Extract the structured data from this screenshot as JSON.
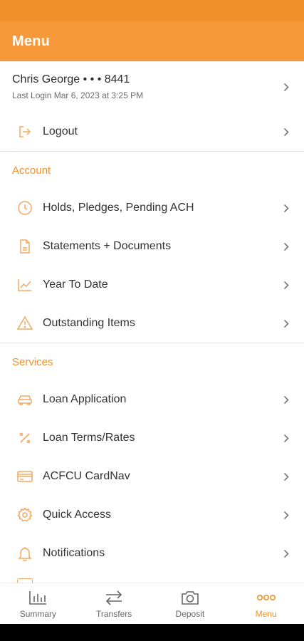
{
  "header": {
    "title": "Menu"
  },
  "user": {
    "name": "Chris George • • • 8441",
    "last_login": "Last Login Mar 6, 2023 at 3:25 PM"
  },
  "logout": {
    "label": "Logout",
    "icon": "logout-icon"
  },
  "account": {
    "title": "Account",
    "items": [
      {
        "label": "Holds, Pledges, Pending ACH",
        "icon": "clock-icon"
      },
      {
        "label": "Statements + Documents",
        "icon": "document-icon"
      },
      {
        "label": "Year To Date",
        "icon": "line-chart-icon"
      },
      {
        "label": "Outstanding Items",
        "icon": "warning-icon"
      }
    ]
  },
  "services": {
    "title": "Services",
    "items": [
      {
        "label": "Loan Application",
        "icon": "car-icon"
      },
      {
        "label": "Loan Terms/Rates",
        "icon": "percent-icon"
      },
      {
        "label": "ACFCU CardNav",
        "icon": "credit-card-icon"
      },
      {
        "label": "Quick Access",
        "icon": "gear-icon"
      },
      {
        "label": "Notifications",
        "icon": "bell-icon"
      }
    ]
  },
  "tabs": [
    {
      "label": "Summary",
      "icon": "bar-chart-icon"
    },
    {
      "label": "Transfers",
      "icon": "transfer-arrows-icon"
    },
    {
      "label": "Deposit",
      "icon": "camera-icon"
    },
    {
      "label": "Menu",
      "icon": "more-dots-icon",
      "active": true
    }
  ],
  "colors": {
    "accent": "#f0902a",
    "header": "#f7993a",
    "icon": "#f3a862",
    "text": "#333333"
  }
}
